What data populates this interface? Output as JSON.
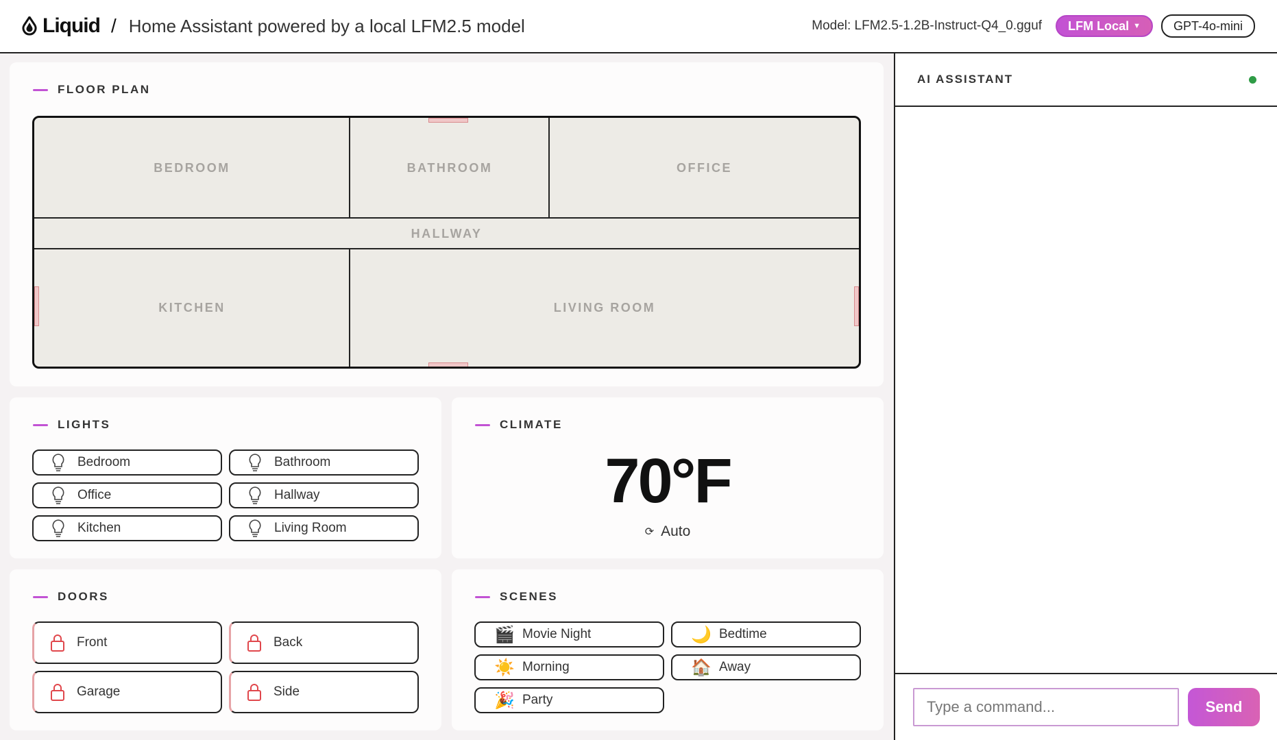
{
  "header": {
    "brand": "Liquid",
    "separator": "/",
    "title": "Home Assistant powered by a local LFM2.5 model",
    "model_label": "Model: LFM2.5-1.2B-Instruct-Q4_0.gguf",
    "provider_selected": "LFM Local",
    "provider_alt": "GPT-4o-mini"
  },
  "floor_plan": {
    "title": "FLOOR PLAN",
    "rooms": {
      "bedroom": "BEDROOM",
      "bathroom": "BATHROOM",
      "office": "OFFICE",
      "hallway": "HALLWAY",
      "kitchen": "KITCHEN",
      "living_room": "LIVING ROOM"
    }
  },
  "lights": {
    "title": "LIGHTS",
    "items": [
      "Bedroom",
      "Bathroom",
      "Office",
      "Hallway",
      "Kitchen",
      "Living Room"
    ]
  },
  "climate": {
    "title": "CLIMATE",
    "temperature": "70°F",
    "mode": "Auto"
  },
  "doors": {
    "title": "DOORS",
    "items": [
      "Front",
      "Back",
      "Garage",
      "Side"
    ]
  },
  "scenes": {
    "title": "SCENES",
    "items": [
      {
        "label": "Movie Night",
        "icon": "🎬",
        "icon_name": "clapperboard-icon"
      },
      {
        "label": "Bedtime",
        "icon": "🌙",
        "icon_name": "moon-icon"
      },
      {
        "label": "Morning",
        "icon": "☀️",
        "icon_name": "sun-icon"
      },
      {
        "label": "Away",
        "icon": "🏠",
        "icon_name": "house-icon"
      },
      {
        "label": "Party",
        "icon": "🎉",
        "icon_name": "party-popper-icon"
      }
    ]
  },
  "assistant": {
    "title": "AI ASSISTANT",
    "input_placeholder": "Type a command...",
    "send_label": "Send"
  },
  "colors": {
    "accent": "#c252d4",
    "status_online": "#2f9c46",
    "door_locked": "#e0474c"
  }
}
